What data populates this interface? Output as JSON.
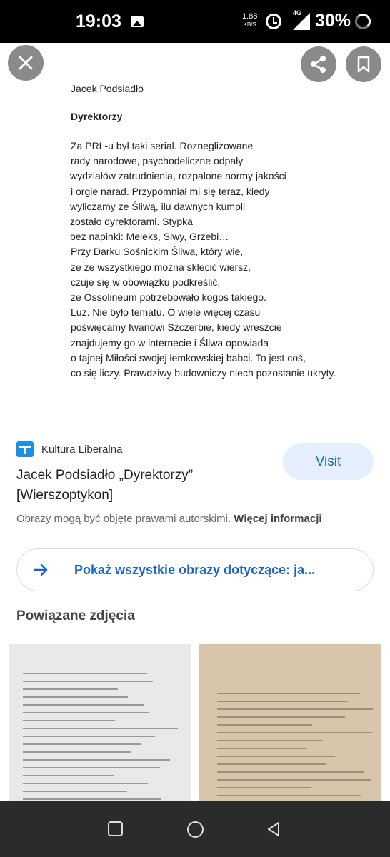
{
  "status": {
    "time": "19:03",
    "speed": "1.88",
    "speed_unit": "KB/S",
    "network": "4G",
    "battery": "30%"
  },
  "poem": {
    "author": "Jacek Podsiadło",
    "title": "Dyrektorzy",
    "lines": [
      "Za PRL-u był taki serial. Roznegliżowane",
      "rady narodowe, psychodeliczne odpały",
      "wydziałów zatrudnienia, rozpalone normy jakości",
      "i orgie narad. Przypomniał mi się teraz, kiedy",
      "wyliczamy ze Śliwą, ilu dawnych kumpli",
      "zostało dyrektorami. Stypka",
      "bez napinki: Meleks, Siwy, Grzebi…",
      "Przy Darku Sośnickim Śliwa, który wie,",
      "że ze wszystkiego można sklecić wiersz,",
      "czuje się w obowiązku podkreślić,",
      "że Ossolineum potrzebowało kogoś takiego.",
      "Luz. Nie było tematu. O wiele więcej czasu",
      "poświęcamy Iwanowi Szczerbie, kiedy wreszcie",
      "znajdujemy go w internecie i Śliwa opowiada",
      "o tajnej Miłości swojej łemkowskiej babci. To jest coś,",
      "co się liczy. Prawdziwy budowniczy niech pozostanie ukryty."
    ]
  },
  "result": {
    "source": "Kultura Liberalna",
    "title": "Jacek Podsiadło „Dyrektorzy” [Wierszoptykon]",
    "visit_label": "Visit",
    "copyright": "Obrazy mogą być objęte prawami autorskimi.",
    "more_info": "Więcej informacji",
    "show_all": "Pokaż wszystkie obrazy dotyczące: ja..."
  },
  "related": {
    "title": "Powiązane zdjęcia"
  },
  "icons": {
    "close": "close-icon",
    "share": "share-icon",
    "bookmark": "bookmark-icon",
    "arrow": "arrow-right-icon",
    "logo": "kultura-liberalna-logo",
    "accent": "#1a63c6"
  }
}
